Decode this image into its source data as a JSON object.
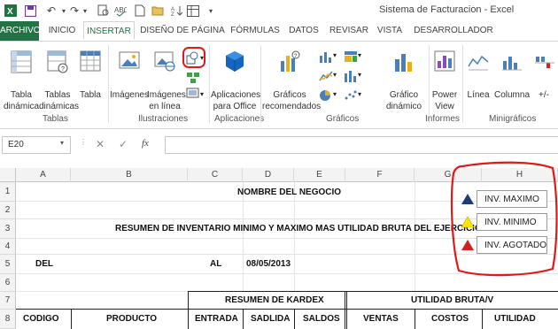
{
  "window": {
    "title": "Sistema de Facturacion - Excel"
  },
  "tabs": [
    "ARCHIVO",
    "INICIO",
    "INSERTAR",
    "DISEÑO DE PÁGINA",
    "FÓRMULAS",
    "DATOS",
    "REVISAR",
    "VISTA",
    "DESARROLLADOR"
  ],
  "active_tab": "INSERTAR",
  "ribbon": {
    "tablas": {
      "label": "Tablas",
      "btn1": [
        "Tabla",
        "dinámica"
      ],
      "btn2": [
        "Tablas",
        "dinámicas"
      ],
      "btn3": "Tabla"
    },
    "ilustraciones": {
      "label": "Ilustraciones",
      "imagenes": "Imágenes",
      "imagenes_linea": [
        "Imágenes",
        "en línea"
      ]
    },
    "aplicaciones": {
      "label": "Aplicaciones",
      "btn": [
        "Aplicaciones",
        "para Office"
      ]
    },
    "graficos": {
      "label": "Gráficos",
      "recomendados": [
        "Gráficos",
        "recomendados"
      ],
      "dinamico": [
        "Gráfico",
        "dinámico"
      ]
    },
    "informes": {
      "label": "Informes",
      "power_view": [
        "Power",
        "View"
      ]
    },
    "minigraficos": {
      "label": "Minigráficos",
      "linea": "Línea",
      "columna": "Columna",
      "ganancia": "+/-"
    }
  },
  "formula_bar": {
    "name_box": "E20",
    "fx": "fx",
    "cancel": "✕",
    "enter": "✓"
  },
  "columns": [
    "A",
    "B",
    "C",
    "D",
    "E",
    "F",
    "G",
    "H"
  ],
  "rows": [
    "1",
    "2",
    "3",
    "4",
    "5",
    "6",
    "7",
    "8"
  ],
  "sheet": {
    "business_name": "NOMBRE DEL NEGOCIO",
    "summary_title": "RESUMEN DE INVENTARIO MINIMO Y MAXIMO MAS UTILIDAD BRUTA DEL EJERCICIO",
    "del_label": "DEL",
    "al_label": "AL",
    "date": "08/05/2013",
    "kardex_header": "RESUMEN DE KARDEX",
    "utilidad_header": "UTILIDAD BRUTA/V",
    "table_headers": [
      "CODIGO",
      "PRODUCTO",
      "ENTRADA",
      "SADLIDA",
      "SALDOS",
      "VENTAS",
      "COSTOS",
      "UTILIDAD"
    ]
  },
  "legend": [
    {
      "label": "INV. MAXIMO",
      "color": "#1f3a78"
    },
    {
      "label": "INV. MINIMO",
      "color": "#ffe600"
    },
    {
      "label": "INV. AGOTADO",
      "color": "#d32020"
    }
  ],
  "colors": {
    "accent": "#217346",
    "annotation": "#e0191b"
  }
}
